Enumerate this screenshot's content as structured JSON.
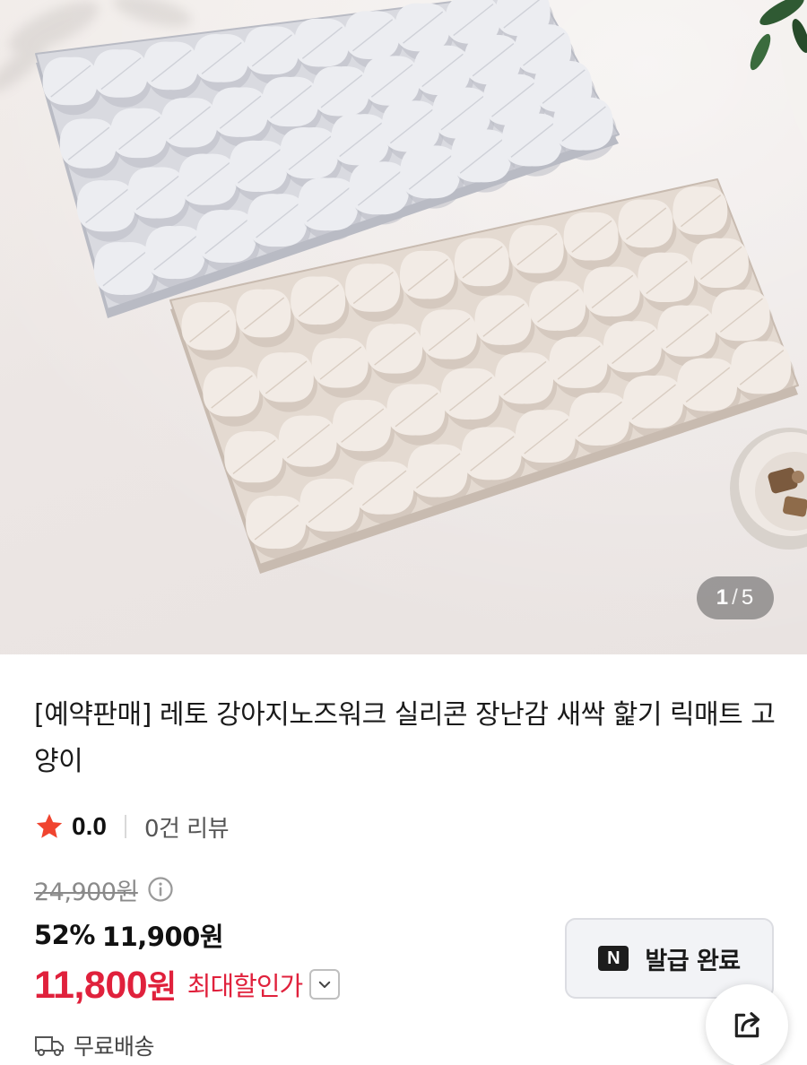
{
  "gallery": {
    "current": "1",
    "separator": "/",
    "total": "5",
    "image_alt": "실리콘 노즈워크 매트 (그레이, 베이지)"
  },
  "product": {
    "title": "[예약판매] 레토 강아지노즈워크 실리콘 장난감 새싹 핥기 릭매트 고양이"
  },
  "rating": {
    "star_icon": "star-icon",
    "value": "0.0",
    "review_count": "0건 리뷰"
  },
  "price": {
    "original": "24,900원",
    "discount_percent": "52%",
    "sale": "11,900원",
    "max_discount_amount": "11,800",
    "max_discount_unit": "원",
    "max_discount_label": "최대할인가"
  },
  "coupon": {
    "badge": "N",
    "label": "발급 완료"
  },
  "shipping": {
    "label": "무료배송"
  },
  "colors": {
    "accent_red": "#e0213c",
    "star": "#f0442f"
  }
}
